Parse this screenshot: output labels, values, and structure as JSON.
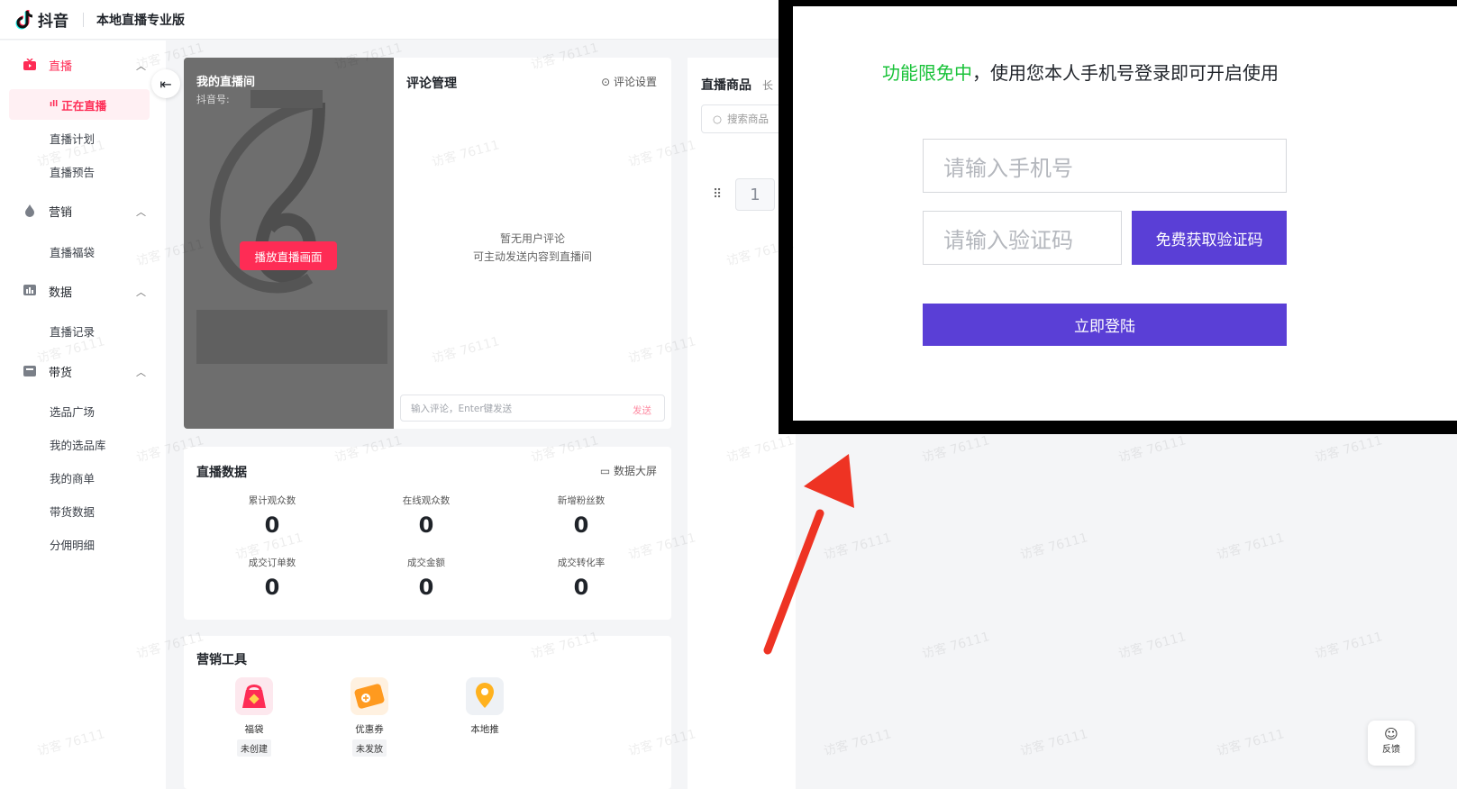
{
  "header": {
    "app_name": "抖音",
    "product_name": "本地直播专业版"
  },
  "sidebar": {
    "groups": [
      {
        "label": "直播",
        "icon": "live-tv-icon",
        "items": [
          "正在直播",
          "直播计划",
          "直播预告"
        ]
      },
      {
        "label": "营销",
        "icon": "flame-icon",
        "items": [
          "直播福袋"
        ]
      },
      {
        "label": "数据",
        "icon": "bar-chart-icon",
        "items": [
          "直播记录"
        ]
      },
      {
        "label": "带货",
        "icon": "shopping-bag-icon",
        "items": [
          "选品广场",
          "我的选品库",
          "我的商单",
          "带货数据",
          "分佣明细"
        ]
      }
    ],
    "active_item": "正在直播"
  },
  "live_room": {
    "title": "我的直播间",
    "douyin_id_label": "抖音号:",
    "play_button": "播放直播画面"
  },
  "comments": {
    "title": "评论管理",
    "settings_label": "评论设置",
    "empty_line1": "暂无用户评论",
    "empty_line2": "可主动发送内容到直播间",
    "input_placeholder": "输入评论，Enter键发送",
    "send_label": "发送"
  },
  "live_data": {
    "title": "直播数据",
    "big_screen_label": "数据大屏",
    "metrics": [
      {
        "label": "累计观众数",
        "value": "0"
      },
      {
        "label": "在线观众数",
        "value": "0"
      },
      {
        "label": "新增粉丝数",
        "value": "0"
      },
      {
        "label": "成交订单数",
        "value": "0"
      },
      {
        "label": "成交金额",
        "value": "0"
      },
      {
        "label": "成交转化率",
        "value": "0"
      }
    ]
  },
  "marketing": {
    "title": "营销工具",
    "tools": [
      {
        "name": "福袋",
        "status": "未创建",
        "icon": "lucky-bag-icon"
      },
      {
        "name": "优惠券",
        "status": "未发放",
        "icon": "coupon-icon"
      },
      {
        "name": "本地推",
        "status": "",
        "icon": "location-pin-icon"
      }
    ]
  },
  "products": {
    "title": "直播商品",
    "title_suffix": "长",
    "search_placeholder": "搜索商品",
    "index": "1"
  },
  "login_modal": {
    "notice_highlight": "功能限免中",
    "notice_rest": "，使用您本人手机号登录即可开启使用",
    "phone_placeholder": "请输入手机号",
    "code_placeholder": "请输入验证码",
    "get_code_button": "免费获取验证码",
    "login_button": "立即登陆"
  },
  "watermark": "访客 76111",
  "feedback_label": "反馈",
  "colors": {
    "brand": "#fe2c55",
    "login_accent": "#5a3fd6",
    "highlight_green": "#18c238",
    "arrow_red": "#ee3323"
  }
}
